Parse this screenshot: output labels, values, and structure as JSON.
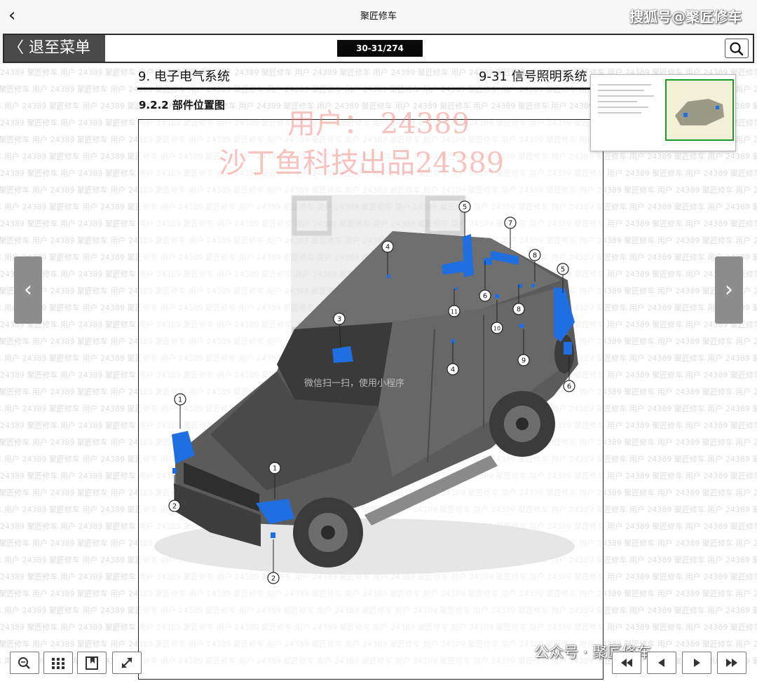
{
  "top_bar": {
    "title": "聚匠修车",
    "watermark": "搜狐号@聚匠修车"
  },
  "toolbar": {
    "back_label": "〈 退至菜单",
    "page_indicator": "30-31/274"
  },
  "document": {
    "header_left": "9. 电子电气系统",
    "header_right": "9-31 信号照明系统",
    "section_title": "9.2.2 部件位置图",
    "callouts": [
      "1",
      "1",
      "2",
      "2",
      "3",
      "4",
      "4",
      "5",
      "5",
      "6",
      "6",
      "7",
      "8",
      "8",
      "9",
      "10",
      "11"
    ]
  },
  "watermarks": {
    "user": "用户：  24389",
    "brand": "沙丁鱼科技出品24389",
    "mini_program": "微信扫一扫，使用小程序",
    "bottom": "公众号 · 聚匠修车",
    "background_text": "24389 聚匠修车 用户"
  },
  "colors": {
    "highlight": "#1f6fe0",
    "vehicle": "#5b5b5b",
    "watermark_red": "#f0786e",
    "thumb_border": "#1a9a2a"
  },
  "icons": [
    "chevron-left-icon",
    "search-icon",
    "zoom-icon",
    "grid-icon",
    "bookmark-icon",
    "expand-icon",
    "first-page-icon",
    "prev-page-icon",
    "next-page-icon",
    "last-page-icon",
    "chevron-right-icon"
  ]
}
